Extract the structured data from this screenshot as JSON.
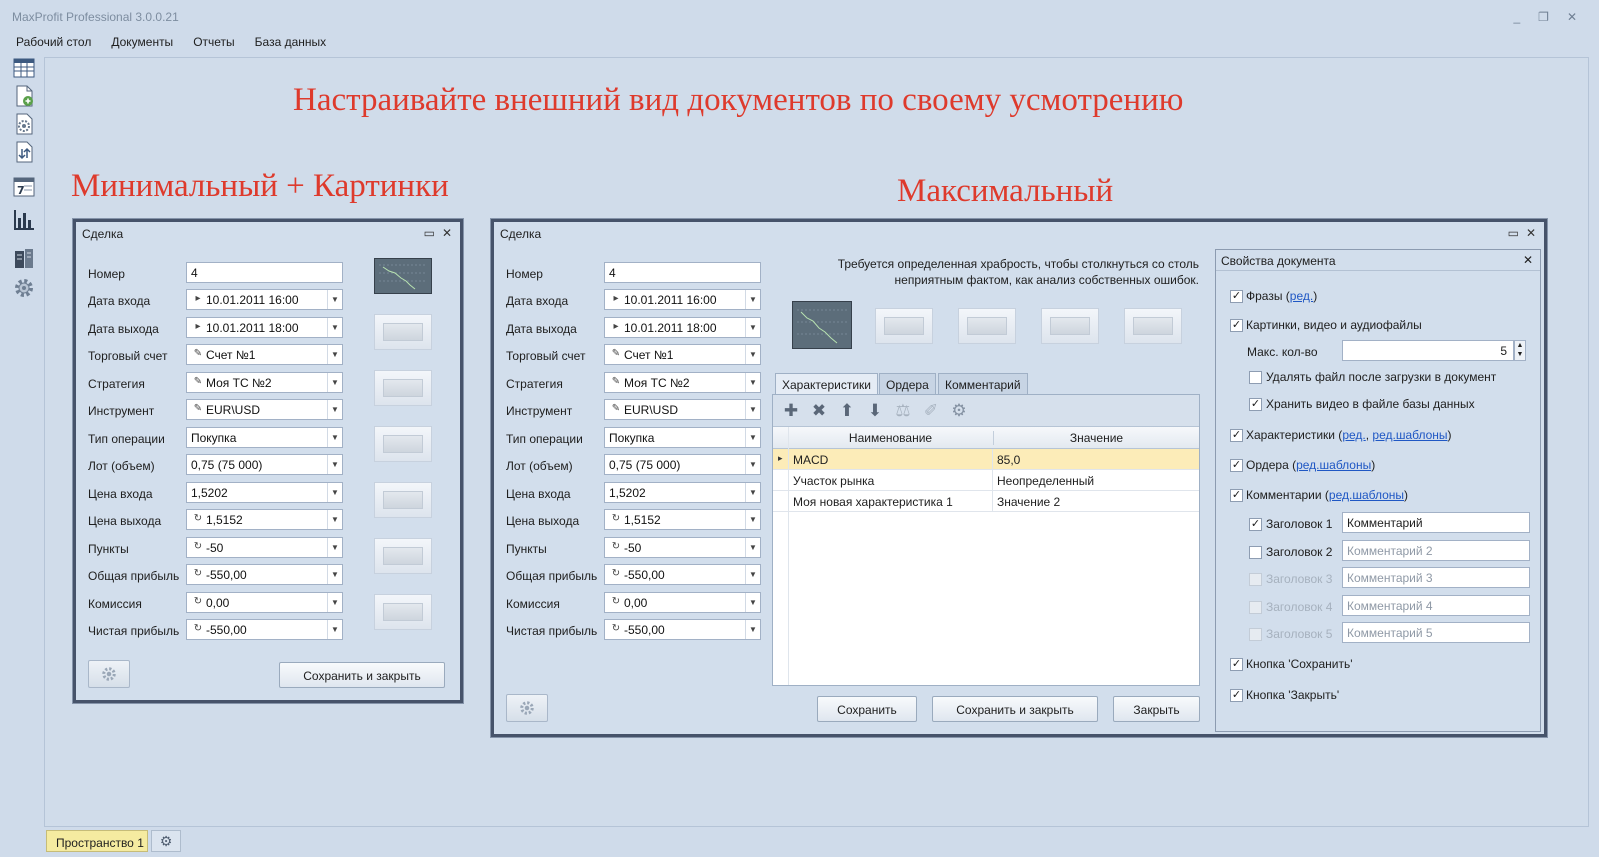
{
  "app": {
    "title": "MaxProfit Professional 3.0.0.21",
    "window_buttons": [
      "_",
      "❐",
      "✕"
    ]
  },
  "menu": [
    "Рабочий стол",
    "Документы",
    "Отчеты",
    "База данных"
  ],
  "banners": {
    "main": "Настраивайте внешний вид документов по своему усмотрению",
    "left": "Минимальный + Картинки",
    "right": "Максимальный"
  },
  "fields": [
    {
      "label": "Номер",
      "value": "4",
      "prefix": ""
    },
    {
      "label": "Дата входа",
      "value": "10.01.2011 16:00",
      "prefix": "▸",
      "dropdown": true
    },
    {
      "label": "Дата выхода",
      "value": "10.01.2011 18:00",
      "prefix": "▸",
      "dropdown": true
    },
    {
      "label": "Торговый счет",
      "value": "Счет №1",
      "prefix": "✎",
      "dropdown": true
    },
    {
      "label": "Стратегия",
      "value": "Моя ТС №2",
      "prefix": "✎",
      "dropdown": true
    },
    {
      "label": "Инструмент",
      "value": "EUR\\USD",
      "prefix": "✎",
      "dropdown": true
    },
    {
      "label": "Тип операции",
      "value": "Покупка",
      "prefix": "",
      "dropdown": true
    },
    {
      "label": "Лот (объем)",
      "value": "0,75 (75 000)",
      "prefix": "",
      "dropdown": true
    },
    {
      "label": "Цена входа",
      "value": "1,5202",
      "prefix": "",
      "dropdown": true
    },
    {
      "label": "Цена выхода",
      "value": "1,5152",
      "prefix": "↻",
      "dropdown": true
    },
    {
      "label": "Пункты",
      "value": "-50",
      "prefix": "↻",
      "dropdown": true
    },
    {
      "label": "Общая прибыль",
      "value": "-550,00",
      "prefix": "↻",
      "dropdown": true
    },
    {
      "label": "Комиссия",
      "value": "0,00",
      "prefix": "↻",
      "dropdown": true
    },
    {
      "label": "Чистая прибыль",
      "value": "-550,00",
      "prefix": "↻",
      "dropdown": true
    }
  ],
  "doc_min": {
    "title": "Сделка",
    "save_close": "Сохранить и закрыть"
  },
  "doc_max": {
    "title": "Сделка",
    "quote": "Требуется определенная храбрость, чтобы столкнуться со столь неприятным фактом, как анализ собственных ошибок.",
    "tabs": [
      "Характеристики",
      "Ордера",
      "Комментарий"
    ],
    "toolbar_icons": [
      "plus-icon",
      "delete-icon",
      "arrow-up-icon",
      "arrow-down-icon",
      "scales-icon",
      "brush-icon",
      "gear-icon"
    ],
    "grid_headers": [
      "Наименование",
      "Значение"
    ],
    "grid_rows": [
      {
        "name": "MACD",
        "value": "85,0"
      },
      {
        "name": "Участок рынка",
        "value": "Неопределенный"
      },
      {
        "name": "Моя новая характеристика 1",
        "value": "Значение 2"
      }
    ],
    "save": "Сохранить",
    "save_close": "Сохранить и закрыть",
    "close": "Закрыть"
  },
  "props": {
    "title": "Свойства документа",
    "phrases": "Фразы (",
    "phrases_link": "ред.",
    "phrases_end": ")",
    "media": "Картинки, видео и аудиофайлы",
    "max_count_label": "Макс. кол-во",
    "max_count": "5",
    "delete_after_load": "Удалять файл после загрузки в документ",
    "store_video": "Хранить видео в файле базы данных",
    "characteristics": "Характеристики (",
    "characteristics_link1": "ред.",
    "characteristics_sep": ", ",
    "characteristics_link2": "ред.шаблоны",
    "characteristics_end": ")",
    "orders": "Ордера (",
    "orders_link": "ред.шаблоны",
    "orders_end": ")",
    "comments": "Комментарии (",
    "comments_link": "ред.шаблоны",
    "comments_end": ")",
    "headers": [
      {
        "label": "Заголовок 1",
        "value": "Комментарий",
        "checked": true,
        "enabled": true
      },
      {
        "label": "Заголовок 2",
        "value": "Комментарий 2",
        "checked": false,
        "enabled": true
      },
      {
        "label": "Заголовок 3",
        "value": "Комментарий 3",
        "checked": false,
        "enabled": false
      },
      {
        "label": "Заголовок 4",
        "value": "Комментарий 4",
        "checked": false,
        "enabled": false
      },
      {
        "label": "Заголовок 5",
        "value": "Комментарий 5",
        "checked": false,
        "enabled": false
      }
    ],
    "save_button": "Кнопка 'Сохранить'",
    "close_button": "Кнопка 'Закрыть'"
  },
  "statusbar": {
    "space_tab": "Пространство 1"
  },
  "colors": {
    "banner": "#de3a2c",
    "background": "#cfdbea",
    "link": "#1f57c4",
    "selected_row": "#fcecb8",
    "space_tab": "#f5eba0"
  }
}
